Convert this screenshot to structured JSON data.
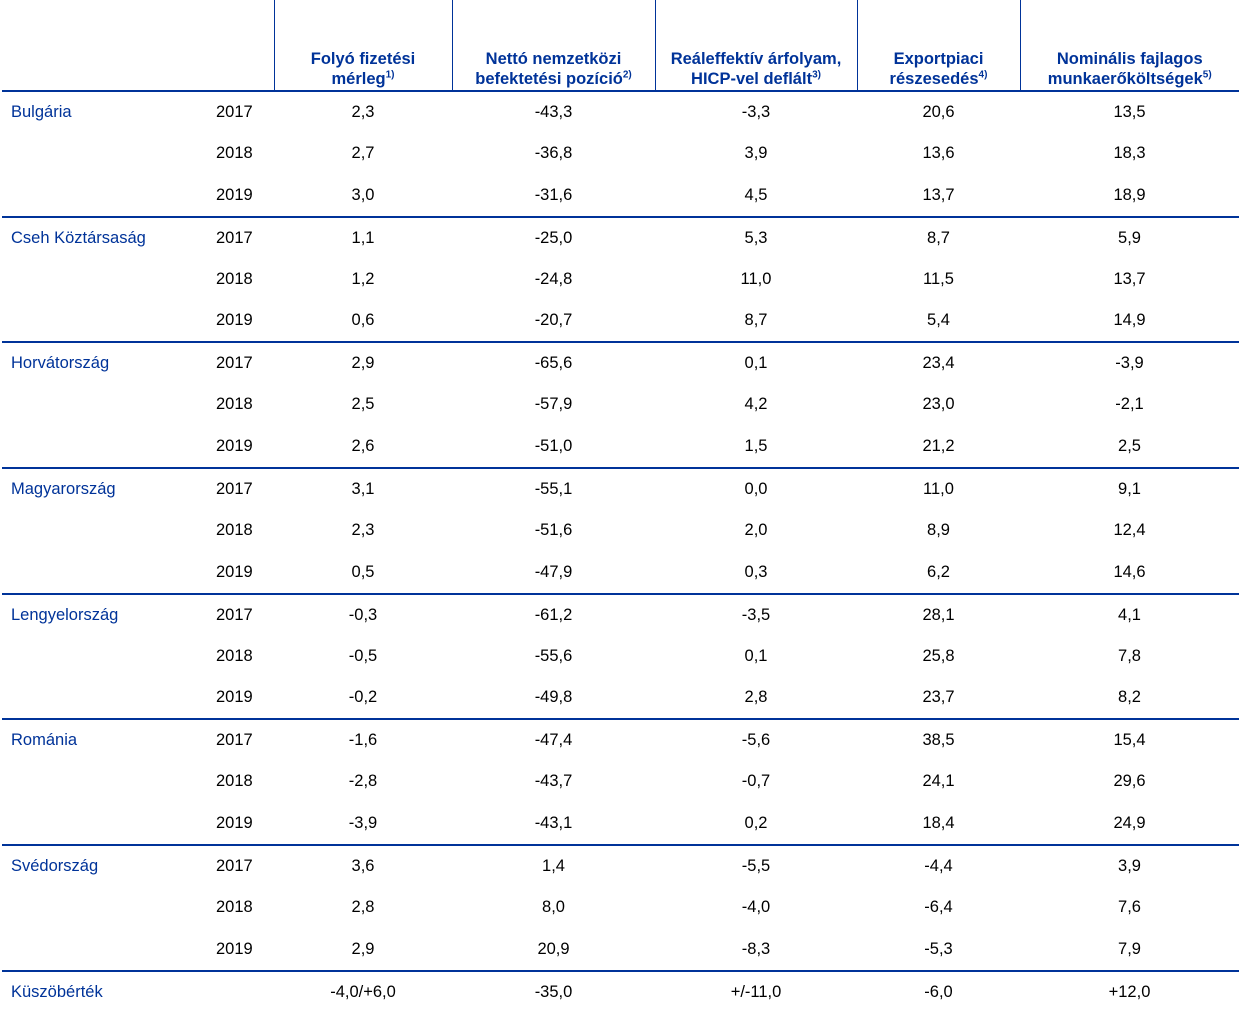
{
  "headers": [
    {
      "label": "Folyó fizetési mérleg",
      "note": "1)"
    },
    {
      "label": "Nettó nemzetközi befektetési pozíció",
      "note": "2)"
    },
    {
      "label": "Reáleffektív árfolyam, HICP-vel deflált",
      "note": "3)"
    },
    {
      "label": "Exportpiaci részesedés",
      "note": "4)"
    },
    {
      "label": "Nominális fajlagos munkaerőköltségek",
      "note": "5)"
    }
  ],
  "countries": [
    {
      "name": "Bulgária",
      "rows": [
        {
          "year": "2017",
          "values": [
            "2,3",
            "-43,3",
            "-3,3",
            "20,6",
            "13,5"
          ]
        },
        {
          "year": "2018",
          "values": [
            "2,7",
            "-36,8",
            "3,9",
            "13,6",
            "18,3"
          ]
        },
        {
          "year": "2019",
          "values": [
            "3,0",
            "-31,6",
            "4,5",
            "13,7",
            "18,9"
          ]
        }
      ]
    },
    {
      "name": "Cseh Köztársaság",
      "rows": [
        {
          "year": "2017",
          "values": [
            "1,1",
            "-25,0",
            "5,3",
            "8,7",
            "5,9"
          ]
        },
        {
          "year": "2018",
          "values": [
            "1,2",
            "-24,8",
            "11,0",
            "11,5",
            "13,7"
          ]
        },
        {
          "year": "2019",
          "values": [
            "0,6",
            "-20,7",
            "8,7",
            "5,4",
            "14,9"
          ]
        }
      ]
    },
    {
      "name": "Horvátország",
      "rows": [
        {
          "year": "2017",
          "values": [
            "2,9",
            "-65,6",
            "0,1",
            "23,4",
            "-3,9"
          ]
        },
        {
          "year": "2018",
          "values": [
            "2,5",
            "-57,9",
            "4,2",
            "23,0",
            "-2,1"
          ]
        },
        {
          "year": "2019",
          "values": [
            "2,6",
            "-51,0",
            "1,5",
            "21,2",
            "2,5"
          ]
        }
      ]
    },
    {
      "name": "Magyarország",
      "rows": [
        {
          "year": "2017",
          "values": [
            "3,1",
            "-55,1",
            "0,0",
            "11,0",
            "9,1"
          ]
        },
        {
          "year": "2018",
          "values": [
            "2,3",
            "-51,6",
            "2,0",
            "8,9",
            "12,4"
          ]
        },
        {
          "year": "2019",
          "values": [
            "0,5",
            "-47,9",
            "0,3",
            "6,2",
            "14,6"
          ]
        }
      ]
    },
    {
      "name": "Lengyelország",
      "rows": [
        {
          "year": "2017",
          "values": [
            "-0,3",
            "-61,2",
            "-3,5",
            "28,1",
            "4,1"
          ]
        },
        {
          "year": "2018",
          "values": [
            "-0,5",
            "-55,6",
            "0,1",
            "25,8",
            "7,8"
          ]
        },
        {
          "year": "2019",
          "values": [
            "-0,2",
            "-49,8",
            "2,8",
            "23,7",
            "8,2"
          ]
        }
      ]
    },
    {
      "name": "Románia",
      "rows": [
        {
          "year": "2017",
          "values": [
            "-1,6",
            "-47,4",
            "-5,6",
            "38,5",
            "15,4"
          ]
        },
        {
          "year": "2018",
          "values": [
            "-2,8",
            "-43,7",
            "-0,7",
            "24,1",
            "29,6"
          ]
        },
        {
          "year": "2019",
          "values": [
            "-3,9",
            "-43,1",
            "0,2",
            "18,4",
            "24,9"
          ]
        }
      ]
    },
    {
      "name": "Svédország",
      "rows": [
        {
          "year": "2017",
          "values": [
            "3,6",
            "1,4",
            "-5,5",
            "-4,4",
            "3,9"
          ]
        },
        {
          "year": "2018",
          "values": [
            "2,8",
            "8,0",
            "-4,0",
            "-6,4",
            "7,6"
          ]
        },
        {
          "year": "2019",
          "values": [
            "2,9",
            "20,9",
            "-8,3",
            "-5,3",
            "7,9"
          ]
        }
      ]
    }
  ],
  "threshold": {
    "label": "Küszöbérték",
    "values": [
      "-4,0/+6,0",
      "-35,0",
      "+/-11,0",
      "-6,0",
      "+12,0"
    ]
  },
  "colors": {
    "accent": "#003399",
    "text": "#000000"
  }
}
